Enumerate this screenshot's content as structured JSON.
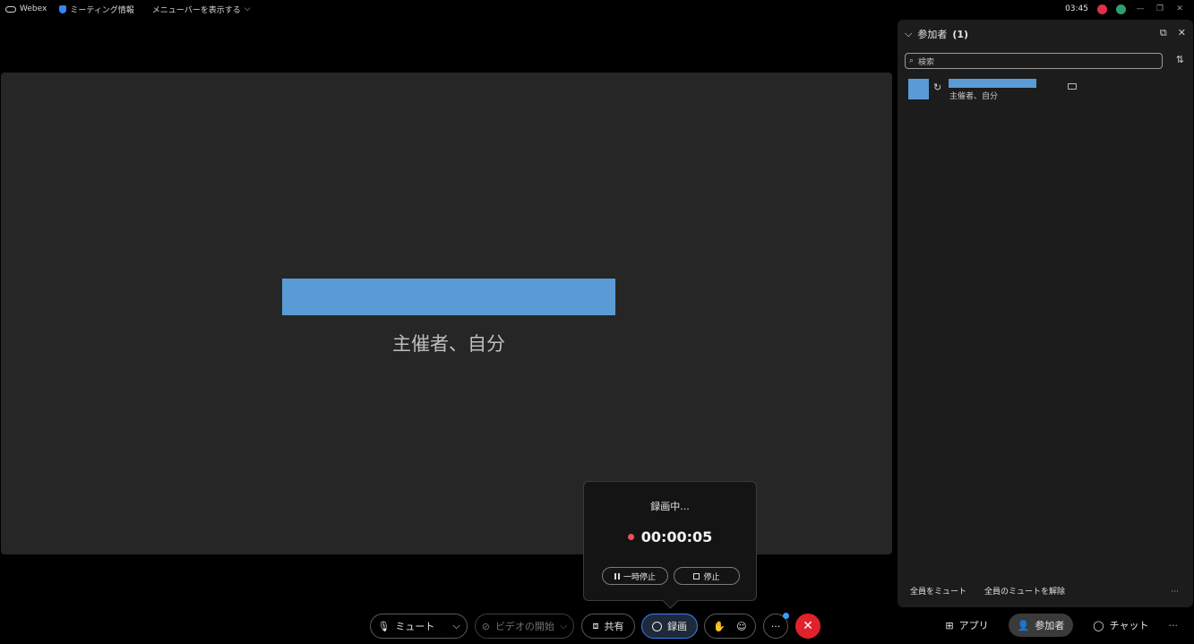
{
  "topbar": {
    "app_name": "Webex",
    "meeting_info": "ミーティング情報",
    "menu_toggle": "メニューバーを表示する",
    "time": "03:45"
  },
  "stage": {
    "participant_label": "主催者、自分"
  },
  "panel": {
    "title": "参加者",
    "count": "(1)",
    "search_placeholder": "検索",
    "participant_role": "主催者、自分",
    "mute_all": "全員をミュート",
    "unmute_all": "全員のミュートを解除",
    "more": "···"
  },
  "recording": {
    "status": "録画中...",
    "time": "00:00:05",
    "pause_label": "一時停止",
    "stop_label": "停止"
  },
  "bottombar": {
    "mute_label": "ミュート",
    "video_label": "ビデオの開始",
    "share_label": "共有",
    "record_label": "録画",
    "more_label": "···",
    "end_label": "✕",
    "apps_label": "アプリ",
    "participants_label": "参加者",
    "chat_label": "チャット",
    "tabs_more": "···"
  },
  "colors": {
    "accent": "#3b82f6",
    "placeholder_blue": "#5b9bd5",
    "end_red": "#e0222c",
    "record_dot": "#f0505a"
  }
}
